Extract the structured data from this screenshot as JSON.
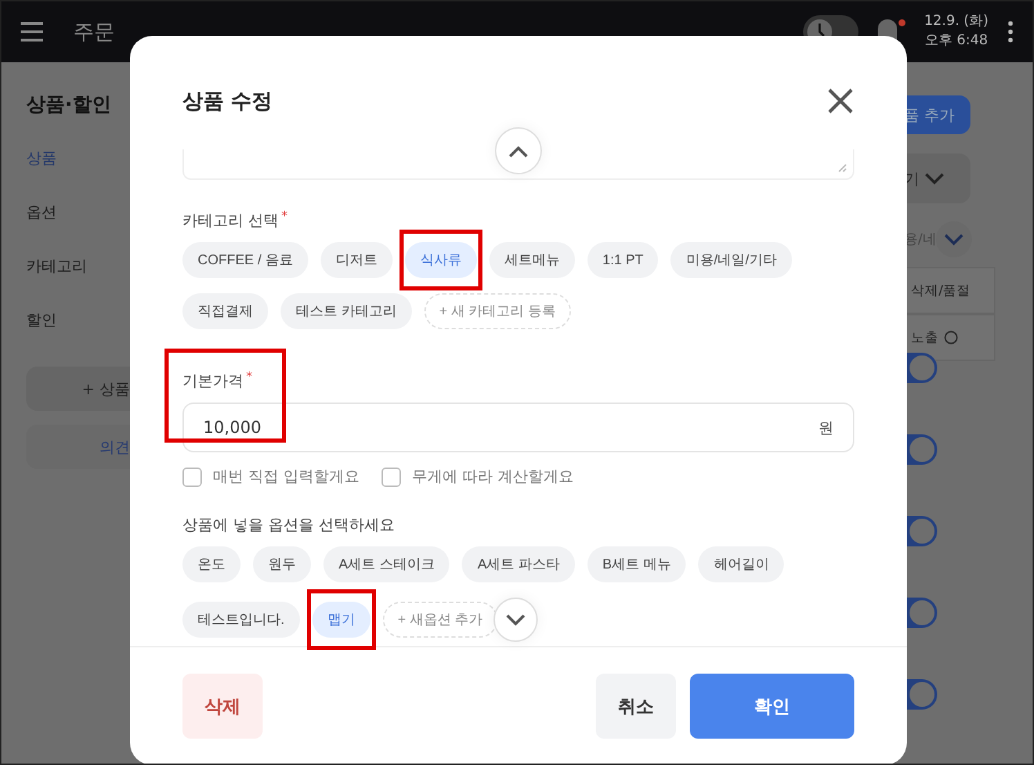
{
  "top_bar": {
    "items": [
      {
        "label": "주문"
      }
    ],
    "clock_toggle": {
      "on": false
    },
    "date": "12.9. (화)",
    "time": "오후 6:48",
    "notification_dot": true
  },
  "sidebar": {
    "title": "상품·할인",
    "items": [
      {
        "label": "상품",
        "selected": true
      },
      {
        "label": "옵션",
        "selected": false
      },
      {
        "label": "카테고리",
        "selected": false
      },
      {
        "label": "할인",
        "selected": false
      }
    ],
    "add_button": "+ 상품",
    "feedback_button": "의견"
  },
  "background_right": {
    "add_button": "품 추가",
    "link": "기",
    "filter": "용/네",
    "column_1": "삭제/품절",
    "column_2": "노출",
    "toggles": [
      {
        "on": true
      },
      {
        "on": true
      },
      {
        "on": true
      },
      {
        "on": true
      },
      {
        "on": true
      }
    ]
  },
  "modal": {
    "title": "상품 수정",
    "category": {
      "label": "카테고리 선택",
      "required_mark": "*",
      "chips": [
        {
          "label": "COFFEE / 음료",
          "selected": false,
          "annotated": false
        },
        {
          "label": "디저트",
          "selected": false,
          "annotated": false
        },
        {
          "label": "식사류",
          "selected": true,
          "annotated": true
        },
        {
          "label": "세트메뉴",
          "selected": false,
          "annotated": false
        },
        {
          "label": "1:1 PT",
          "selected": false,
          "annotated": false
        },
        {
          "label": "미용/네일/기타",
          "selected": false,
          "annotated": false
        },
        {
          "label": "직접결제",
          "selected": false,
          "annotated": false
        },
        {
          "label": "테스트 카테고리",
          "selected": false,
          "annotated": false
        }
      ],
      "add_label": "+ 새 카테고리 등록"
    },
    "price": {
      "label": "기본가격",
      "required_mark": "*",
      "value": "10,000",
      "unit": "원",
      "annotated": true
    },
    "price_options": [
      {
        "label": "매번 직접 입력할게요",
        "checked": false
      },
      {
        "label": "무게에 따라 계산할게요",
        "checked": false
      }
    ],
    "options": {
      "label": "상품에 넣을 옵션을 선택하세요",
      "chips": [
        {
          "label": "온도",
          "selected": false,
          "annotated": false
        },
        {
          "label": "원두",
          "selected": false,
          "annotated": false
        },
        {
          "label": "A세트 스테이크",
          "selected": false,
          "annotated": false
        },
        {
          "label": "A세트 파스타",
          "selected": false,
          "annotated": false
        },
        {
          "label": "B세트 메뉴",
          "selected": false,
          "annotated": false
        },
        {
          "label": "헤어길이",
          "selected": false,
          "annotated": false
        },
        {
          "label": "테스트입니다.",
          "selected": false,
          "annotated": false
        },
        {
          "label": "맵기",
          "selected": true,
          "annotated": true
        }
      ],
      "add_label": "+ 새옵션 추가"
    },
    "buttons": {
      "delete": "삭제",
      "cancel": "취소",
      "confirm": "확인"
    }
  }
}
